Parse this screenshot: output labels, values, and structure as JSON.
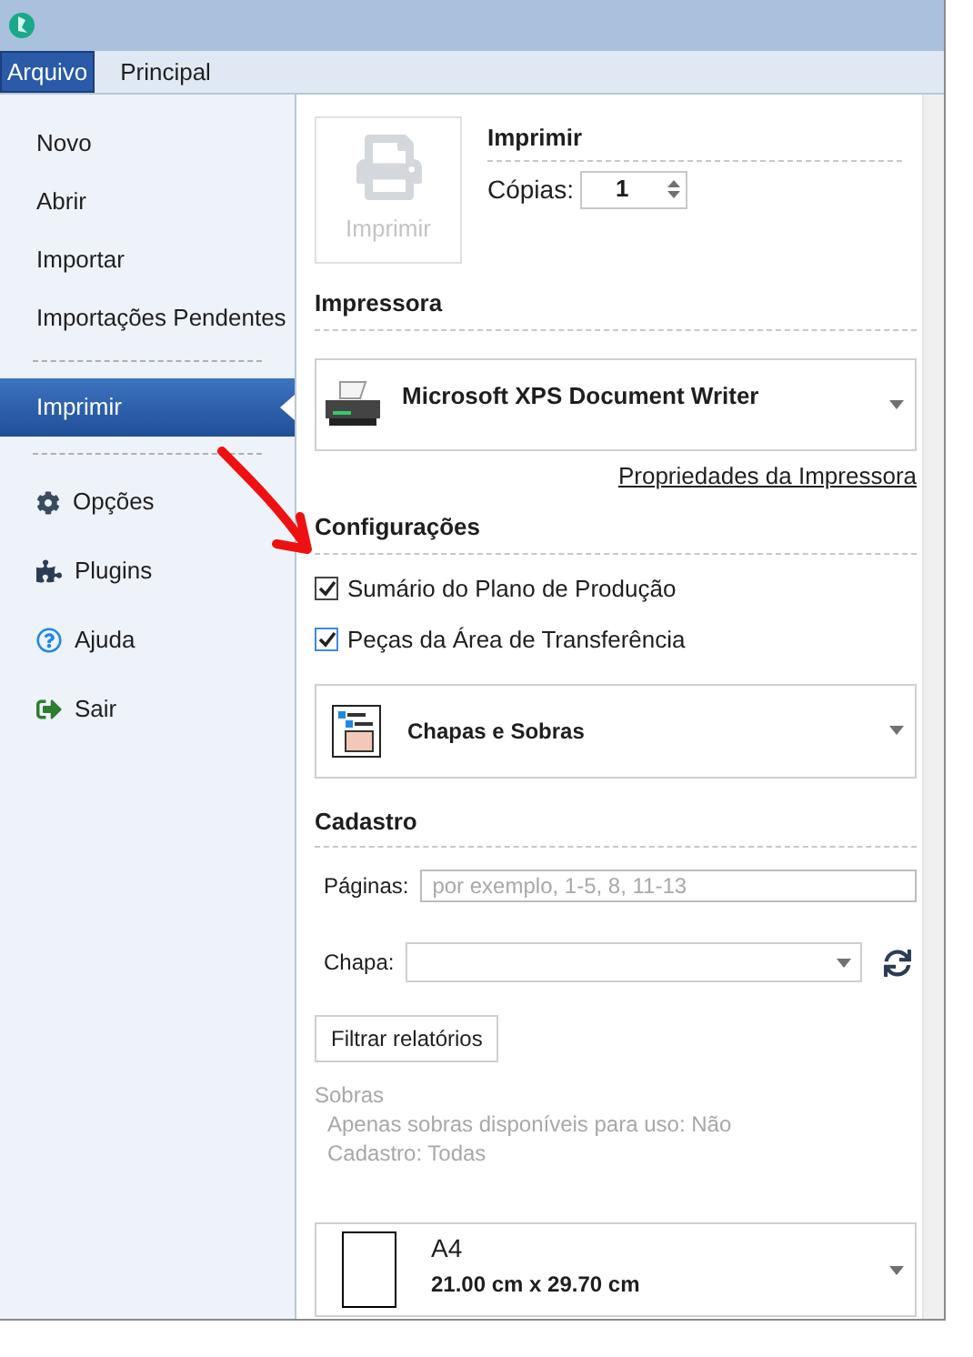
{
  "menu_tabs": [
    {
      "label": "Arquivo",
      "selected": true
    },
    {
      "label": "Principal",
      "selected": false
    }
  ],
  "sidebar": {
    "groups": [
      [
        {
          "label": "Novo",
          "selected": false
        },
        {
          "label": "Abrir",
          "selected": false
        },
        {
          "label": "Importar",
          "selected": false
        },
        {
          "label": "Importações Pendentes",
          "selected": false
        }
      ],
      [
        {
          "label": "Imprimir",
          "selected": true
        }
      ],
      [
        {
          "label": "Opções",
          "selected": false,
          "kind": "gear"
        },
        {
          "label": "Plugins",
          "selected": false,
          "kind": "puzzle"
        },
        {
          "label": "Ajuda",
          "selected": false,
          "kind": "help"
        },
        {
          "label": "Sair",
          "selected": false,
          "kind": "exit"
        }
      ]
    ]
  },
  "print": {
    "button_label": "Imprimir",
    "button_disabled": true,
    "heading": "Imprimir",
    "copies_label": "Cópias:",
    "copies_value": "1"
  },
  "printer": {
    "heading": "Impressora",
    "name": "Microsoft XPS Document Writer",
    "properties_link": "Propriedades da Impressora"
  },
  "settings": {
    "heading": "Configurações",
    "options": [
      {
        "label": "Sumário do Plano de Produção",
        "checked": true
      },
      {
        "label": "Peças da Área de Transferência",
        "checked": true
      }
    ],
    "report": "Chapas e Sobras"
  },
  "cadastro": {
    "heading": "Cadastro",
    "pages_label": "Páginas:",
    "pages_placeholder": "por exemplo, 1-5, 8, 11-13",
    "sheet_label": "Chapa:",
    "filter_button": "Filtrar relatórios",
    "summary_title": "Sobras",
    "summary_lines": [
      "Apenas sobras disponíveis para uso: Não",
      "Cadastro: Todas"
    ]
  },
  "paper": {
    "name": "A4",
    "size": "21.00 cm x 29.70 cm"
  }
}
